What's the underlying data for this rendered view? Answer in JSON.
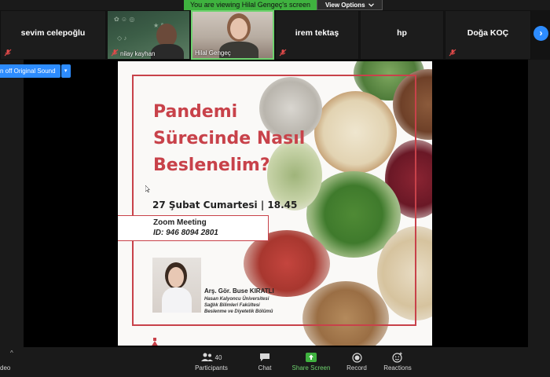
{
  "banner": {
    "viewing_text": "You are viewing Hilal Gengeç's screen",
    "view_options_label": "View Options"
  },
  "participants": [
    {
      "name": "sevim celepoğlu"
    },
    {
      "name": "nilay kayhan"
    },
    {
      "name": "Hilal Gengeç"
    },
    {
      "name": "irem tektaş"
    },
    {
      "name": "hp"
    },
    {
      "name": "Doğa KOÇ"
    }
  ],
  "original_sound": {
    "label": "n off Original Sound"
  },
  "slide": {
    "title_line1": "Pandemi",
    "title_line2": "Sürecinde Nasıl",
    "title_line3": "Beslenelim?",
    "date_time": "27 Şubat Cumartesi | 18.45",
    "meeting_label": "Zoom Meeting",
    "meeting_id": "ID: 946 8094 2801",
    "speaker_name": "Arş. Gör. Buse KIRATLI",
    "affiliation_line1": "Hasan Kalyoncu Üniversitesi",
    "affiliation_line2": "Sağlık Bilimleri Fakültesi",
    "affiliation_line3": "Beslenme ve Diyetetik Bölümü",
    "accent_color": "#c8424a"
  },
  "toolbar": {
    "video_label": "deo",
    "participants_label": "Participants",
    "participants_count": "40",
    "chat_label": "Chat",
    "share_screen_label": "Share Screen",
    "record_label": "Record",
    "reactions_label": "Reactions",
    "share_color": "#6fd36f"
  }
}
